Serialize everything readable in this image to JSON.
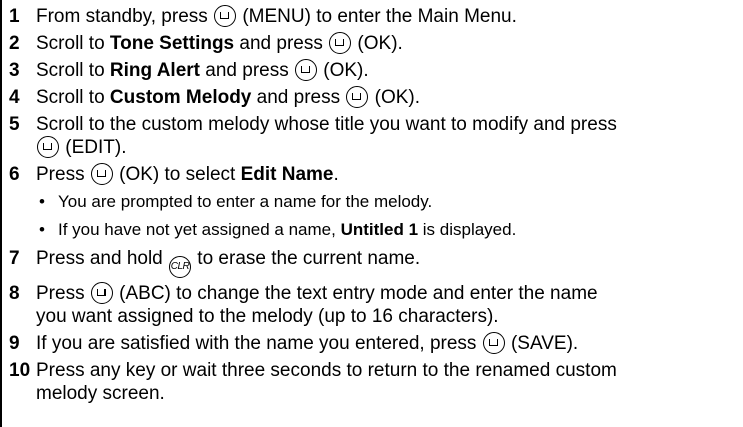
{
  "steps": [
    {
      "num": "1",
      "parts": [
        "From standby, press ",
        "(MENU) to enter the Main Menu."
      ]
    },
    {
      "num": "2",
      "a": "Scroll to ",
      "b": "Tone Settings",
      "c": " and press ",
      "d": "(OK)."
    },
    {
      "num": "3",
      "a": "Scroll to ",
      "b": "Ring Alert",
      "c": " and press ",
      "d": "(OK)."
    },
    {
      "num": "4",
      "a": "Scroll to ",
      "b": "Custom Melody",
      "c": " and press ",
      "d": "(OK)."
    },
    {
      "num": "5",
      "line1": "Scroll to the custom melody whose title you want to modify and press",
      "line2": "(EDIT)."
    },
    {
      "num": "6",
      "a": "Press ",
      "b": "(OK) to select ",
      "c": "Edit Name",
      "d": "."
    },
    {
      "num": "7",
      "a": "Press and hold ",
      "clr": "CLR",
      "b": " to erase the current name."
    },
    {
      "num": "8",
      "a": "Press ",
      "b": "(ABC) to change the text entry mode and enter the name",
      "line2": "you want assigned to the melody (up to 16 characters)."
    },
    {
      "num": "9",
      "a": "If you are satisfied with the name you entered, press ",
      "b": "(SAVE)."
    },
    {
      "num": "10",
      "line1": "Press any key or wait three seconds to return to the renamed custom",
      "line2": "melody screen."
    }
  ],
  "bullets": [
    {
      "text": "You are prompted to enter a name for the melody."
    },
    {
      "a": "If you have not yet assigned a name, ",
      "b": "Untitled 1",
      "c": " is displayed."
    }
  ]
}
